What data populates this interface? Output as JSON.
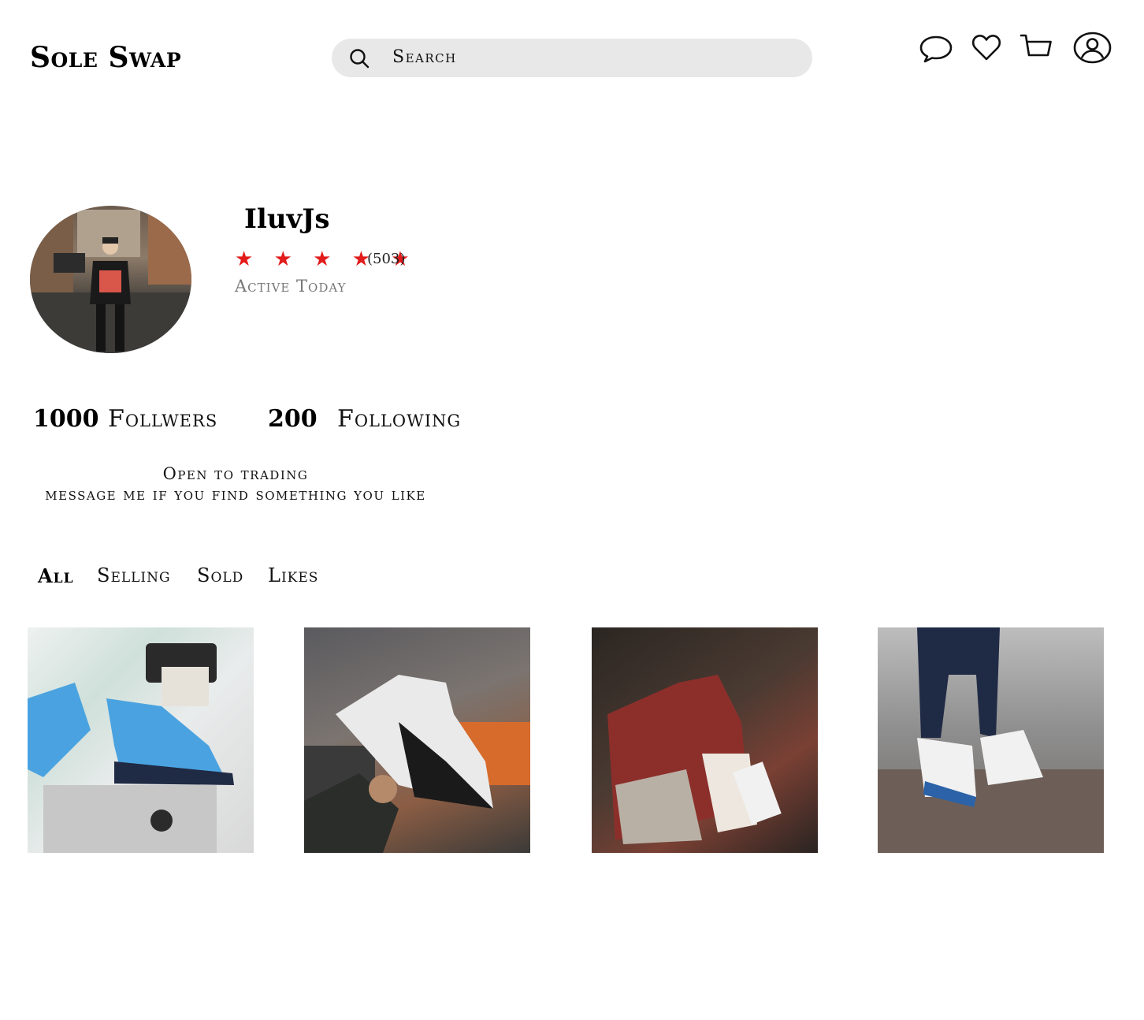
{
  "header": {
    "logo": "Sole Swap",
    "search_placeholder": "Search"
  },
  "icons": [
    "message-icon",
    "heart-icon",
    "cart-icon",
    "user-icon"
  ],
  "profile": {
    "username": "IluvJs",
    "stars": "★ ★ ★ ★ ★",
    "rating_count": "(503)",
    "status": "Active Today",
    "followers_count": "1000",
    "followers_label": "Follwers",
    "following_count": "200",
    "following_label": "Following",
    "bio_line1": "Open to trading",
    "bio_line2": "message me if you find something you like"
  },
  "tabs": [
    {
      "label": "All",
      "active": true
    },
    {
      "label": "Selling",
      "active": false
    },
    {
      "label": "Sold",
      "active": false
    },
    {
      "label": "Likes",
      "active": false
    }
  ],
  "colors": {
    "star": "#e21b1b",
    "search_bg": "#e8e8e8",
    "muted_text": "#777777"
  }
}
